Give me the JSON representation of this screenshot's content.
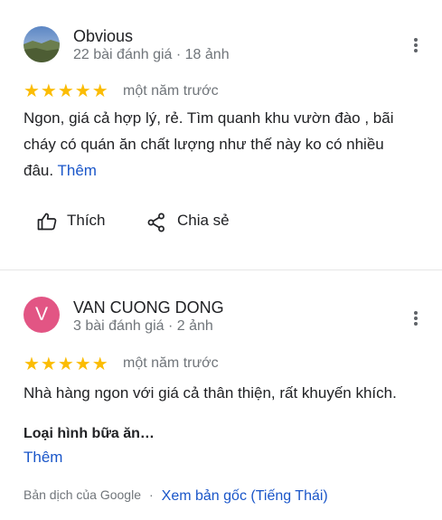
{
  "reviews": [
    {
      "reviewer": "Obvious",
      "meta": "22 bài đánh giá · 18 ảnh",
      "rating": 5,
      "stars": "★★★★★",
      "when": "một năm trước",
      "text": "Ngon, giá cả hợp lý, rẻ. Tìm quanh khu vườn đào , bãi cháy có quán ăn chất lượng như thế này ko có nhiều đâu.",
      "more_link": "Thêm",
      "actions": {
        "like": "Thích",
        "share": "Chia sẻ"
      }
    },
    {
      "reviewer": "VAN CUONG DONG",
      "avatar_letter": "V",
      "avatar_color": "#e25584",
      "meta": "3 bài đánh giá · 2 ảnh",
      "rating": 5,
      "stars": "★★★★★",
      "when": "một năm trước",
      "text": "Nhà hàng ngon với giá cả thân thiện, rất khuyến khích.",
      "subheading": "Loại hình bữa ăn…",
      "more_link": "Thêm",
      "translation_note": "Bản dịch của Google",
      "translation_separator": "·",
      "view_original": "Xem bản gốc (Tiếng Thái)"
    }
  ],
  "colors": {
    "star": "#fbbc04",
    "link": "#1a56c9",
    "secondary_text": "#70757a"
  }
}
